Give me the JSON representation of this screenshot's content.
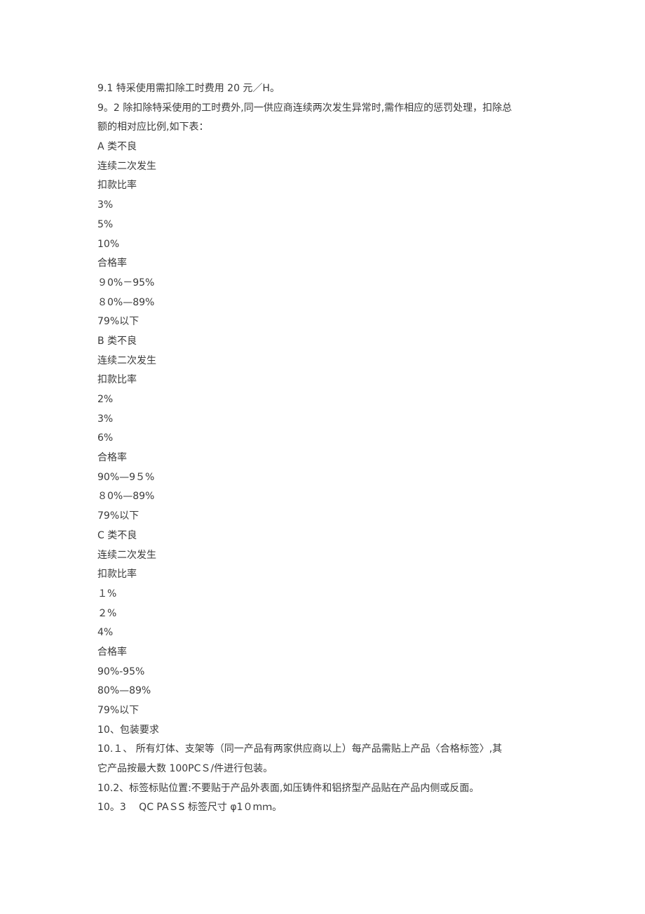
{
  "document": {
    "section_9": {
      "line_9_1": "9.1 特采使用需扣除工时费用 20 元／H。",
      "line_9_2a": "9。2 除扣除特采使用的工时费外,同一供应商连续两次发生异常时,需作相应的惩罚处理，扣除总",
      "line_9_2b": "额的相对应比例,如下表："
    },
    "tables": [
      {
        "category": "A 类不良",
        "occurrence_label": "连续二次发生",
        "deduction_header": "扣款比率",
        "deductions": [
          "3%",
          "5%",
          "10%"
        ],
        "pass_rate_header": "合格率",
        "pass_rates": [
          "９0%－95%",
          "８0%—89%",
          "79%以下"
        ]
      },
      {
        "category": "B 类不良",
        "occurrence_label": "连续二次发生",
        "deduction_header": "扣款比率",
        "deductions": [
          "2%",
          "3%",
          "6%"
        ],
        "pass_rate_header": "合格率",
        "pass_rates": [
          "90%—9５%",
          "８0%—89%",
          "79%以下"
        ]
      },
      {
        "category": "C 类不良",
        "occurrence_label": "连续二次发生",
        "deduction_header": "扣款比率",
        "deductions": [
          "１%",
          "２%",
          "4%"
        ],
        "pass_rate_header": "合格率",
        "pass_rates": [
          "90%-95%",
          "80%—89%",
          "79%以下"
        ]
      }
    ],
    "section_10": {
      "title": "10、包装要求",
      "line_10_1a": "10.１、 所有灯体、支架等（同一产品有两家供应商以上）每产品需贴上产品〈合格标签〉,其",
      "line_10_1b": "它产品按最大数 100PCＳ/件进行包装。",
      "line_10_2": "10.2、标签标贴位置:不要贴于产品外表面,如压铸件和铝挤型产品贴在产品内侧或反面。",
      "line_10_3": "10。3　 QC PAＳS 标签尺寸 φ1０mｍ。"
    }
  }
}
